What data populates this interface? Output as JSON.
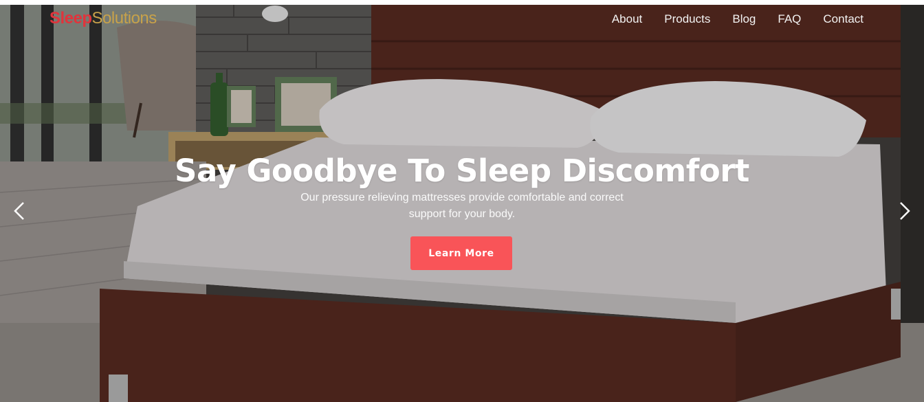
{
  "brand": {
    "part1": "Sleep",
    "part2": "Solutions"
  },
  "nav": {
    "items": [
      "About",
      "Products",
      "Blog",
      "FAQ",
      "Contact"
    ]
  },
  "hero": {
    "headline": "Say Goodbye To Sleep Discomfort",
    "subtext_line1": "Our pressure relieving mattresses provide comfortable and correct",
    "subtext_line2": "support for your body.",
    "cta_label": "Learn More"
  },
  "carousel": {
    "prev_icon": "chevron-left-icon",
    "next_icon": "chevron-right-icon"
  },
  "colors": {
    "accent": "#f95458",
    "brand_red": "#e0343c",
    "brand_gold": "#c8a24a"
  }
}
